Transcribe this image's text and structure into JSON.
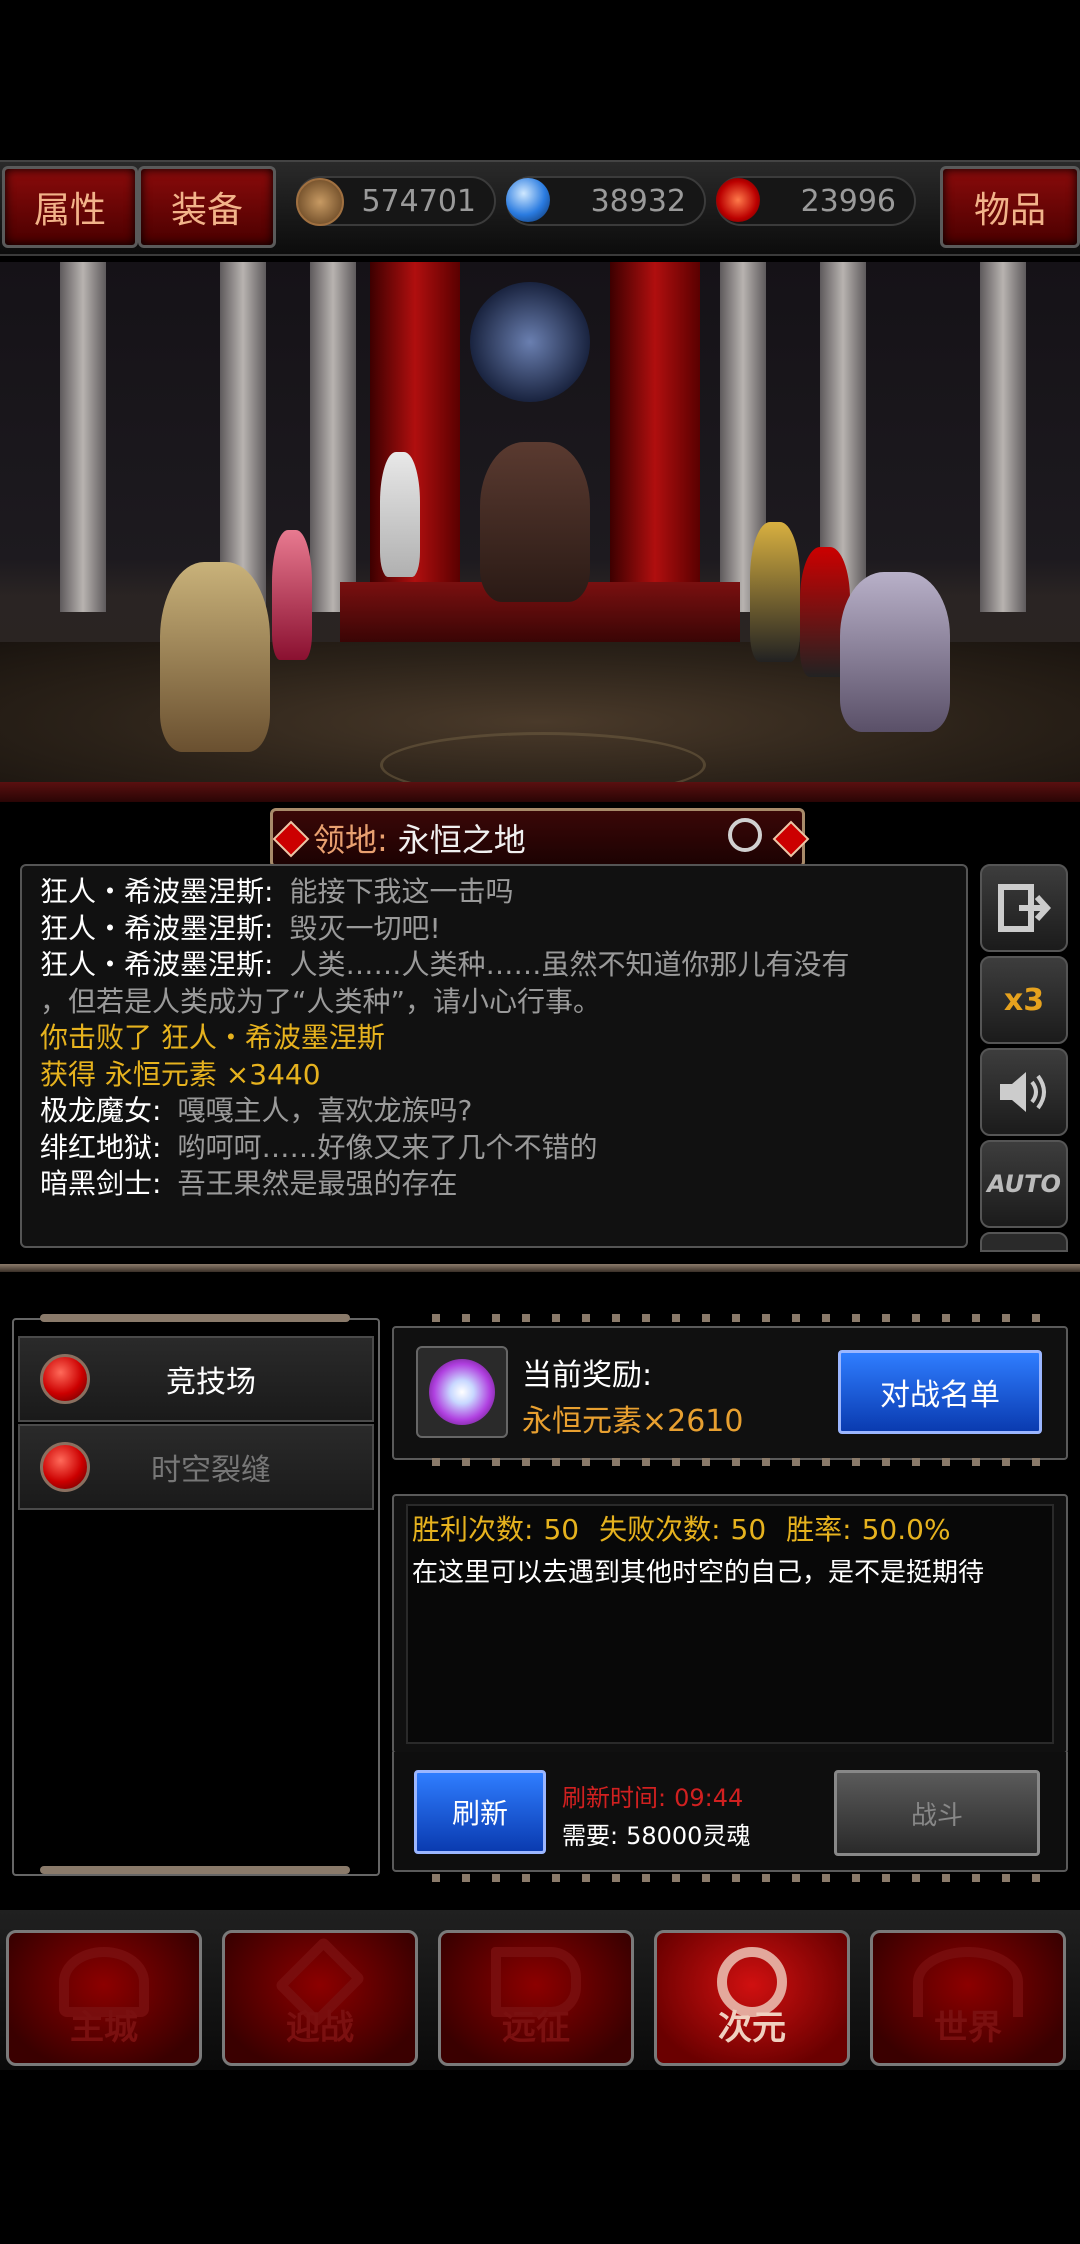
{
  "topbar": {
    "attributes_label": "属性",
    "equipment_label": "装备",
    "items_label": "物品",
    "resources": [
      {
        "icon": "star-coin-icon",
        "value": "574701"
      },
      {
        "icon": "blue-gem-icon",
        "value": "38932"
      },
      {
        "icon": "red-swirl-icon",
        "value": "23996"
      }
    ]
  },
  "location": {
    "prefix": "领地:",
    "name": "永恒之地"
  },
  "log": [
    {
      "speaker": "狂人・希波墨涅斯:",
      "text": "能接下我这一击吗",
      "color": "#ffffff"
    },
    {
      "speaker": "狂人・希波墨涅斯:",
      "text": "毁灭一切吧!",
      "color": "#ffffff"
    },
    {
      "speaker": "狂人・希波墨涅斯:",
      "text": "人类……人类种……虽然不知道你那儿有没有",
      "color": "#ffffff"
    },
    {
      "speaker": "",
      "text": "，但若是人类成为了“人类种”，请小心行事。",
      "color": "#ffffff"
    },
    {
      "speaker": "你击败了 狂人・希波墨涅斯",
      "text": "",
      "color": "#e6b21e"
    },
    {
      "speaker": "获得 永恒元素 ×3440",
      "text": "",
      "color": "#e6b21e"
    },
    {
      "speaker": "极龙魔女:",
      "text": "嘎嘎主人，喜欢龙族吗?",
      "color": "#ffffff"
    },
    {
      "speaker": "绯红地狱:",
      "text": "哟呵呵……好像又来了几个不错的",
      "color": "#ffffff"
    },
    {
      "speaker": "暗黑剑士:",
      "text": "吾王果然是最强的存在",
      "color": "#ffffff"
    }
  ],
  "side_buttons": {
    "exit_icon": "exit-icon",
    "speed_label": "x3",
    "sound_icon": "speaker-icon",
    "auto_label": "AUTO"
  },
  "modes": [
    {
      "label": "竞技场",
      "active": true
    },
    {
      "label": "时空裂缝",
      "active": false
    }
  ],
  "reward": {
    "title": "当前奖励:",
    "item": "永恒元素×2610",
    "battle_list_label": "对战名单"
  },
  "stats": {
    "wins_label": "胜利次数:",
    "wins": "50",
    "losses_label": "失败次数:",
    "losses": "50",
    "rate_label": "胜率:",
    "rate": "50.0%",
    "description": "在这里可以去遇到其他时空的自己，是不是挺期待"
  },
  "refresh": {
    "button_label": "刷新",
    "time_label": "刷新时间:",
    "time": "09:44",
    "cost_label": "需要:",
    "cost": "58000灵魂",
    "fight_label": "战斗"
  },
  "nav": [
    {
      "label": "主城",
      "active": false
    },
    {
      "label": "迎战",
      "active": false
    },
    {
      "label": "远征",
      "active": false
    },
    {
      "label": "次元",
      "active": true
    },
    {
      "label": "世界",
      "active": false
    }
  ]
}
